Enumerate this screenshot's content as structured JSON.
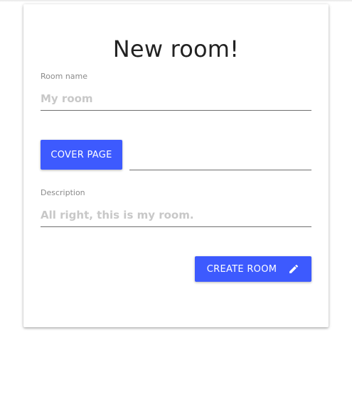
{
  "form": {
    "title": "New room!",
    "room_name": {
      "label": "Room name",
      "value": "",
      "placeholder": "My room"
    },
    "cover_page": {
      "button_label": "COVER PAGE",
      "value": ""
    },
    "description": {
      "label": "Description",
      "value": "",
      "placeholder": "All right, this is my room."
    },
    "submit": {
      "label": "CREATE ROOM",
      "icon": "pencil-icon"
    }
  },
  "colors": {
    "accent": "#3d5afe",
    "title_text": "#222222",
    "label_text": "#8a8a8a",
    "placeholder_text": "#c8c8c8",
    "underline": "#6e6e6e"
  }
}
